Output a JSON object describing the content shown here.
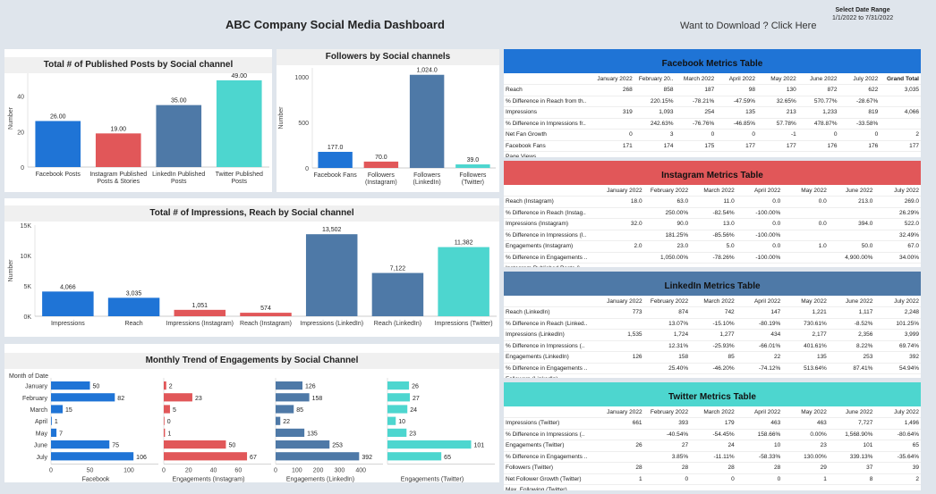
{
  "header": {
    "title": "ABC Company Social Media Dashboard",
    "download": "Want to Download ? Click Here",
    "date_label": "Select Date Range",
    "date_value": "1/1/2022 to 7/31/2022"
  },
  "colors": {
    "facebook": "#1f74d6",
    "instagram": "#e15759",
    "linkedin": "#4e79a7",
    "twitter": "#4dd6cf"
  },
  "posts_chart": {
    "title": "Total # of Published Posts by Social channel",
    "ylabel": "Number",
    "ticks": [
      "0",
      "20",
      "40"
    ],
    "chart_data": {
      "type": "bar",
      "categories": [
        "Facebook Posts",
        "Instagram Published Posts & Stories",
        "LinkedIn Published Posts",
        "Twitter Published Posts"
      ],
      "values": [
        26,
        19,
        35,
        49
      ],
      "labels": [
        "26.00",
        "19.00",
        "35.00",
        "49.00"
      ],
      "ylim": [
        0,
        55
      ]
    }
  },
  "followers_chart": {
    "title": "Followers by Social channels",
    "ylabel": "Number",
    "ticks": [
      "0",
      "500",
      "1000"
    ],
    "chart_data": {
      "type": "bar",
      "categories": [
        "Facebook Fans",
        "Followers (Instagram)",
        "Followers (LinkedIn)",
        "Followers (Twitter)"
      ],
      "values": [
        177,
        70,
        1024,
        39
      ],
      "labels": [
        "177.0",
        "70.0",
        "1,024.0",
        "39.0"
      ],
      "ylim": [
        0,
        1100
      ]
    }
  },
  "impr_chart": {
    "title": "Total # of Impressions, Reach by Social channel",
    "ylabel": "Number",
    "ticks": [
      "0K",
      "5K",
      "10K",
      "15K"
    ],
    "chart_data": {
      "type": "bar",
      "categories": [
        "Impressions",
        "Reach",
        "Impressions (Instagram)",
        "Reach (Instagram)",
        "Impressions (LinkedIn)",
        "Reach (LinkedIn)",
        "Impressions (Twitter)"
      ],
      "values": [
        4066,
        3035,
        1051,
        574,
        13502,
        7122,
        11382
      ],
      "labels": [
        "4,066",
        "3,035",
        "1,051",
        "574",
        "13,502",
        "7,122",
        "11,382"
      ],
      "ylim": [
        0,
        15000
      ]
    }
  },
  "trend_chart": {
    "title": "Monthly Trend of Engagements by Social Channel",
    "month_header": "Month of Date",
    "months": [
      "January",
      "February",
      "March",
      "April",
      "May",
      "June",
      "July"
    ],
    "chart_data": {
      "type": "bar",
      "orientation": "horizontal",
      "categories": [
        "January",
        "February",
        "March",
        "April",
        "May",
        "June",
        "July"
      ],
      "series": [
        {
          "name": "Facebook",
          "values": [
            50,
            82,
            15,
            1,
            7,
            75,
            106
          ],
          "ticks": [
            "0",
            "50",
            "100"
          ],
          "max": 115
        },
        {
          "name": "Engagements (Instagram)",
          "values": [
            2,
            23,
            5,
            0,
            1,
            50,
            67
          ],
          "ticks": [
            "0",
            "20",
            "40",
            "60"
          ],
          "max": 72
        },
        {
          "name": "Engagements (LinkedIn)",
          "values": [
            126,
            158,
            85,
            22,
            135,
            253,
            392
          ],
          "ticks": [
            "0",
            "100",
            "200",
            "300",
            "400"
          ],
          "max": 420
        },
        {
          "name": "Engagements (Twitter)",
          "values": [
            26,
            27,
            24,
            10,
            23,
            101,
            65
          ],
          "ticks": [],
          "max": 108
        }
      ]
    }
  },
  "fb_table": {
    "title": "Facebook Metrics Table",
    "columns": [
      "",
      "January 2022",
      "February 20..",
      "March 2022",
      "April 2022",
      "May 2022",
      "June 2022",
      "July 2022",
      "Grand Total"
    ],
    "rows": [
      [
        "Reach",
        "268",
        "858",
        "187",
        "98",
        "130",
        "872",
        "622",
        "3,035"
      ],
      [
        "% Difference in Reach from th..",
        "",
        "220.15%",
        "-78.21%",
        "-47.59%",
        "32.65%",
        "570.77%",
        "-28.67%",
        ""
      ],
      [
        "Impressions",
        "319",
        "1,093",
        "254",
        "135",
        "213",
        "1,233",
        "819",
        "4,066"
      ],
      [
        "% Difference in Impressions fr..",
        "",
        "242.63%",
        "-76.76%",
        "-46.85%",
        "57.78%",
        "478.87%",
        "-33.58%",
        ""
      ],
      [
        "Net Fan Growth",
        "0",
        "3",
        "0",
        "0",
        "-1",
        "0",
        "0",
        "2"
      ],
      [
        "Facebook Fans",
        "171",
        "174",
        "175",
        "177",
        "177",
        "176",
        "176",
        "177"
      ],
      [
        "Page Views",
        "",
        "",
        "",
        "",
        "",
        "",
        "",
        ""
      ]
    ]
  },
  "ig_table": {
    "title": "Instagram Metrics Table",
    "columns": [
      "",
      "January 2022",
      "February 2022",
      "March 2022",
      "April 2022",
      "May 2022",
      "June 2022",
      "July 2022"
    ],
    "rows": [
      [
        "Reach (Instagram)",
        "18.0",
        "63.0",
        "11.0",
        "0.0",
        "0.0",
        "213.0",
        "269.0"
      ],
      [
        "% Difference in Reach (Instag..",
        "",
        "250.00%",
        "-82.54%",
        "-100.00%",
        "",
        "",
        "26.29%"
      ],
      [
        "Impressions (Instagram)",
        "32.0",
        "90.0",
        "13.0",
        "0.0",
        "0.0",
        "394.0",
        "522.0"
      ],
      [
        "% Difference in Impressions (I..",
        "",
        "181.25%",
        "-85.56%",
        "-100.00%",
        "",
        "",
        "32.49%"
      ],
      [
        "Engagements (Instagram)",
        "2.0",
        "23.0",
        "5.0",
        "0.0",
        "1.0",
        "50.0",
        "67.0"
      ],
      [
        "% Difference in Engagements ..",
        "",
        "1,050.00%",
        "-78.26%",
        "-100.00%",
        "",
        "4,900.00%",
        "34.00%"
      ],
      [
        "Instagram Published Posts &..",
        "",
        "",
        "",
        "",
        "",
        "",
        ""
      ]
    ]
  },
  "li_table": {
    "title": "LinkedIn Metrics Table",
    "columns": [
      "",
      "January 2022",
      "February 2022",
      "March 2022",
      "April 2022",
      "May 2022",
      "June 2022",
      "July 2022"
    ],
    "rows": [
      [
        "Reach (LinkedIn)",
        "773",
        "874",
        "742",
        "147",
        "1,221",
        "1,117",
        "2,248"
      ],
      [
        "% Difference in Reach (Linked..",
        "",
        "13.07%",
        "-15.10%",
        "-80.19%",
        "730.61%",
        "-8.52%",
        "101.25%"
      ],
      [
        "Impressions (LinkedIn)",
        "1,535",
        "1,724",
        "1,277",
        "434",
        "2,177",
        "2,356",
        "3,999"
      ],
      [
        "% Difference in Impressions (..",
        "",
        "12.31%",
        "-25.93%",
        "-66.01%",
        "401.61%",
        "8.22%",
        "69.74%"
      ],
      [
        "Engagements (LinkedIn)",
        "126",
        "158",
        "85",
        "22",
        "135",
        "253",
        "392"
      ],
      [
        "% Difference in Engagements ..",
        "",
        "25.40%",
        "-46.20%",
        "-74.12%",
        "513.64%",
        "87.41%",
        "54.94%"
      ],
      [
        "Followers (LinkedIn)",
        "",
        "",
        "",
        "",
        "",
        "",
        ""
      ]
    ]
  },
  "tw_table": {
    "title": "Twitter Metrics Table",
    "columns": [
      "",
      "January 2022",
      "February 2022",
      "March 2022",
      "April 2022",
      "May 2022",
      "June 2022",
      "July 2022"
    ],
    "rows": [
      [
        "Impressions (Twitter)",
        "661",
        "393",
        "179",
        "463",
        "463",
        "7,727",
        "1,496"
      ],
      [
        "% Difference in Impressions (..",
        "",
        "-40.54%",
        "-54.45%",
        "158.66%",
        "0.00%",
        "1,568.90%",
        "-80.64%"
      ],
      [
        "Engagements (Twitter)",
        "26",
        "27",
        "24",
        "10",
        "23",
        "101",
        "65"
      ],
      [
        "% Difference in Engagements ..",
        "",
        "3.85%",
        "-11.11%",
        "-58.33%",
        "130.00%",
        "339.13%",
        "-35.64%"
      ],
      [
        "Followers (Twitter)",
        "28",
        "28",
        "28",
        "28",
        "29",
        "37",
        "39"
      ],
      [
        "Net Follower Growth (Twitter)",
        "1",
        "0",
        "0",
        "0",
        "1",
        "8",
        "2"
      ],
      [
        "Max. Following (Twitter)",
        "",
        "",
        "",
        "",
        "",
        "",
        ""
      ]
    ]
  }
}
